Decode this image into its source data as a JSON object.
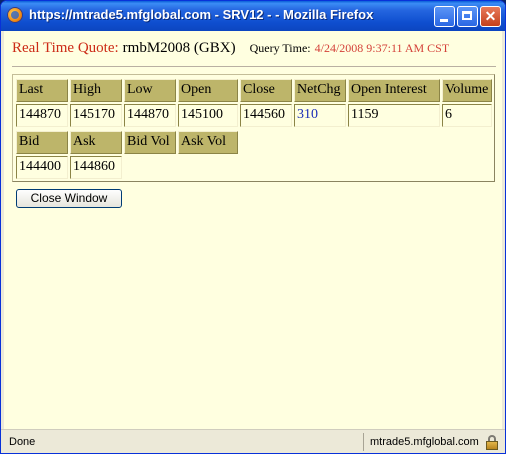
{
  "window": {
    "title": "https://mtrade5.mfglobal.com - SRV12 - - Mozilla Firefox",
    "icon": "firefox-icon"
  },
  "quote": {
    "label": "Real Time Quote:",
    "instrument": "rmbM2008 (GBX)",
    "query_time_label": "Query Time:",
    "query_time_value": "4/24/2008 9:37:11 AM CST"
  },
  "table1": {
    "headers": [
      "Last",
      "High",
      "Low",
      "Open",
      "Close",
      "NetChg",
      "Open Interest",
      "Volume"
    ],
    "values": [
      "144870",
      "145170",
      "144870",
      "145100",
      "144560",
      "310",
      "1159",
      "6"
    ]
  },
  "table2": {
    "headers": [
      "Bid",
      "Ask",
      "Bid Vol",
      "Ask Vol"
    ],
    "values": [
      "144400",
      "144860"
    ]
  },
  "buttons": {
    "close_window": "Close Window"
  },
  "status": {
    "left": "Done",
    "right": "mtrade5.mfglobal.com"
  },
  "colors": {
    "quote_label": "#cc2a16",
    "query_time_value": "#d4423a",
    "header_bg": "#bdb56a",
    "page_bg": "#ffffe0",
    "netchg": "#1b2db8"
  }
}
